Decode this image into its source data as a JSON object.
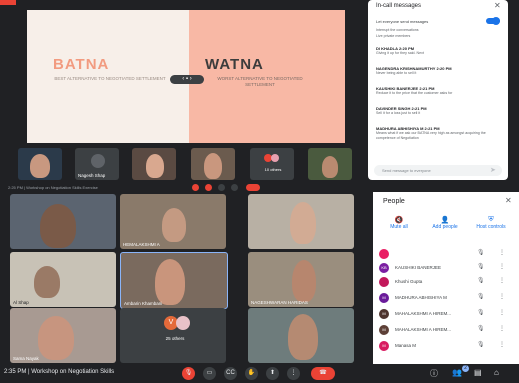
{
  "slide": {
    "left_title": "BATNA",
    "left_subtitle": "BEST ALTERNATIVE TO NEGOTIATED SETTLEMENT",
    "right_title": "WATNA",
    "right_subtitle": "WORST ALTERNATIVE TO NEGOTIATED SETTLEMENT"
  },
  "chat": {
    "title": "In-call messages",
    "allow_label": "Let everyone send messages",
    "info_line1": "Interrupt the conversations",
    "info_line2": "Live private members",
    "messages": [
      {
        "name": "DI KHADLA 2:20 PM",
        "text": "Giving it up for they said. Next"
      },
      {
        "name": "NAGENDRA KRISHNAMURTHY 2:20 PM",
        "text": "Never being able to sell it"
      },
      {
        "name": "KAUSHIKI BANERJEE 2:21 PM",
        "text": "Reduce it to the price that the customer asks for"
      },
      {
        "name": "DAVINDER SINGH 2:21 PM",
        "text": "Sell it for a loss just to sell it"
      },
      {
        "name": "MADHURA ABHISHIYA M 2:21 PM",
        "text": "Means what if we ask our BATNA very high as amongst acquiring the competence of Negotiation"
      }
    ],
    "input_placeholder": "Send message to everyone",
    "send_icon": "send-icon",
    "close_icon": "close-icon"
  },
  "strip": {
    "others_label": "10 others",
    "names": [
      "",
      "Nagesh Shap",
      "",
      ""
    ]
  },
  "top_bar": {
    "text": "2:25 PM | Workshop on Negotiation Skills Exercise"
  },
  "gallery": {
    "tiles": [
      {
        "name": ""
      },
      {
        "name": "HEMALAKSHMI A"
      },
      {
        "name": ""
      },
      {
        "name": "Al Shap"
      },
      {
        "name": "Ambarin Khambani"
      },
      {
        "name": "NAGESHWARAN HARIDAS"
      },
      {
        "name": "Sama Nayak"
      },
      {
        "name": "25 others"
      },
      {
        "name": ""
      }
    ]
  },
  "people": {
    "title": "People",
    "close_icon": "close-icon",
    "actions": [
      "Mute all",
      "Add people",
      "Host controls"
    ],
    "rows": [
      {
        "initials": "",
        "name": "",
        "color": "#e91e63"
      },
      {
        "initials": "KB",
        "name": "KAUSHIKI BANERJEE",
        "color": "#7b1fa2"
      },
      {
        "initials": "",
        "name": "Khushi Gupta",
        "color": "#c2185b"
      },
      {
        "initials": "M",
        "name": "MADHURA ABHISHIYA M",
        "color": "#6a1b9a"
      },
      {
        "initials": "M",
        "name": "MAHALAKSHMI A HIREM...",
        "color": "#4e342e"
      },
      {
        "initials": "M",
        "name": "MAHALAKSHMI A HIREM...",
        "color": "#5d4037"
      },
      {
        "initials": "M",
        "name": "Manasa M",
        "color": "#d81b60"
      }
    ]
  },
  "bottom_bar": {
    "left_text": "2:35 PM | Workshop on Negotiation Skills",
    "controls": [
      "mic-icon",
      "camera-icon",
      "captions-icon",
      "hand-icon",
      "present-icon",
      "more-icon",
      "end-call-icon"
    ],
    "right_icons": [
      "info-icon",
      "people-icon",
      "chat-icon",
      "activities-icon"
    ],
    "people_count": "2"
  },
  "colors": {
    "dark_bg": "#202124",
    "slide_right": "#f8b8a5",
    "slide_left": "#f7efe9",
    "accent_red": "#ea4335",
    "accent_blue": "#1a73e8"
  }
}
